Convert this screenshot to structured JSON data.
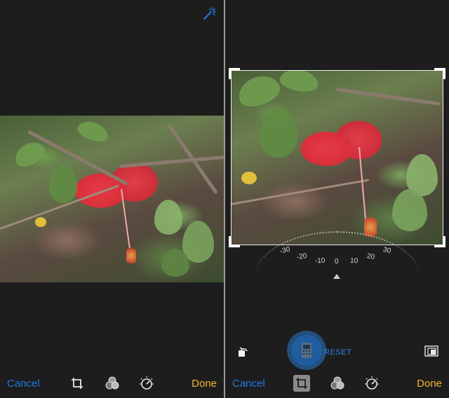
{
  "left_panel": {
    "toolbar": {
      "cancel_label": "Cancel",
      "done_label": "Done",
      "icons": [
        "crop-icon",
        "filters-icon",
        "adjust-icon"
      ]
    },
    "top_icon": "magic-wand-icon"
  },
  "right_panel": {
    "dial": {
      "labels": [
        "-30",
        "-20",
        "-10",
        "0",
        "10",
        "20",
        "30"
      ],
      "value": 0
    },
    "reset_label": "RESET",
    "toolbar": {
      "cancel_label": "Cancel",
      "done_label": "Done",
      "icons": [
        "crop-icon",
        "filters-icon",
        "adjust-icon"
      ],
      "active_icon": "crop-icon"
    },
    "left_tool_icon": "rotate-icon",
    "right_tool_icon": "aspect-ratio-icon"
  },
  "colors": {
    "accent_blue": "#1f7ae0",
    "done_yellow": "#f2b52a",
    "background": "#1d1d1d"
  }
}
